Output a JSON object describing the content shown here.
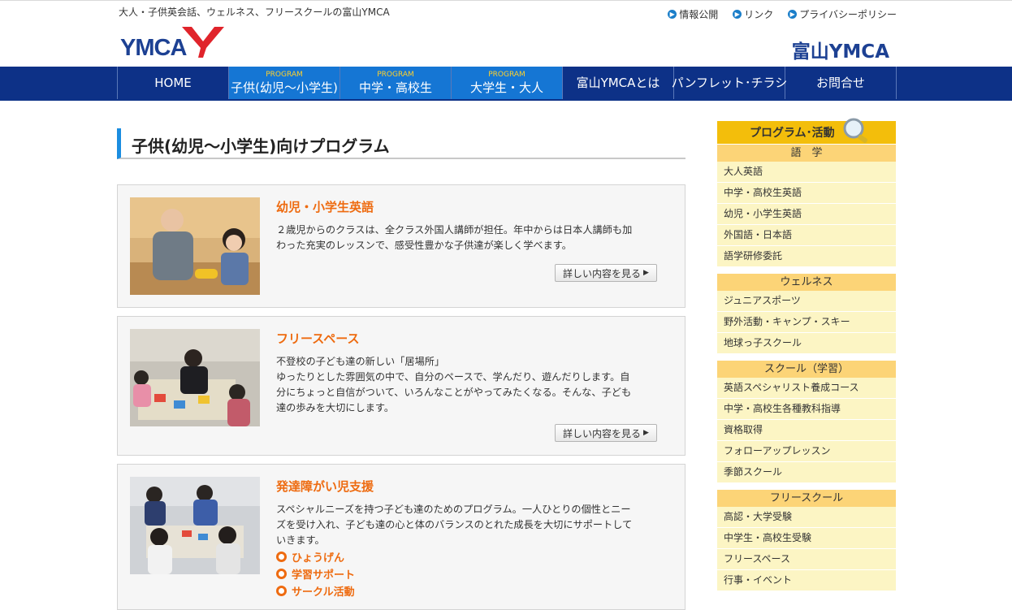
{
  "header": {
    "tagline": "大人・子供英会話、ウェルネス、フリースクールの富山YMCA",
    "utility_links": [
      "情報公開",
      "リンク",
      "プライバシーポリシー"
    ],
    "logo_text": "YMCA",
    "brand": "富山YMCA"
  },
  "nav": {
    "items": [
      {
        "sub": "",
        "label": "HOME"
      },
      {
        "sub": "PROGRAM",
        "label": "子供(幼児〜小学生)"
      },
      {
        "sub": "PROGRAM",
        "label": "中学・高校生"
      },
      {
        "sub": "PROGRAM",
        "label": "大学生・大人"
      },
      {
        "sub": "",
        "label": "富山YMCAとは"
      },
      {
        "sub": "",
        "label": "パンフレット･チラシ"
      },
      {
        "sub": "",
        "label": "お問合せ"
      }
    ]
  },
  "page": {
    "title": "子供(幼児〜小学生)向けプログラム"
  },
  "programs": [
    {
      "title": "幼児・小学生英語",
      "lines": [
        "２歳児からのクラスは、全クラス外国人講師が担任。年中からは日本人講師も加",
        "わった充実のレッスンで、感受性豊かな子供達が楽しく学べます。"
      ],
      "more": "詳しい内容を見る"
    },
    {
      "title": "フリースペース",
      "lines": [
        "不登校の子ども達の新しい「居場所」",
        "ゆったりとした雰囲気の中で、自分のペースで、学んだり、遊んだりします。自",
        "分にちょっと自信がついて、いろんなことがやってみたくなる。そんな、子ども",
        "達の歩みを大切にします。"
      ],
      "more": "詳しい内容を見る"
    },
    {
      "title": "発達障がい児支援",
      "lines": [
        "スペシャルニーズを持つ子ども達のためのプログラム。一人ひとりの個性とニー",
        "ズを受け入れ、子ども達の心と体のバランスのとれた成長を大切にサポートして",
        "いきます。"
      ],
      "links": [
        "ひょうげん",
        "学習サポート",
        "サークル活動"
      ]
    }
  ],
  "sidebar": {
    "header": "プログラム･活動",
    "categories": [
      {
        "name": "語　学",
        "items": [
          "大人英語",
          "中学・高校生英語",
          "幼児・小学生英語",
          "外国語・日本語",
          "語学研修委託"
        ]
      },
      {
        "name": "ウェルネス",
        "items": [
          "ジュニアスポーツ",
          "野外活動・キャンプ・スキー",
          "地球っ子スクール"
        ]
      },
      {
        "name": "スクール（学習）",
        "items": [
          "英語スペシャリスト養成コース",
          "中学・高校生各種教科指導",
          "資格取得",
          "フォローアップレッスン",
          "季節スクール"
        ]
      },
      {
        "name": "フリースクール",
        "items": [
          "高認・大学受験",
          "中学生・高校生受験",
          "フリースペース",
          "行事・イベント"
        ]
      }
    ]
  },
  "colors": {
    "nav_bg": "#0d3187",
    "nav_active": "#1576d4",
    "accent_orange": "#ee6b10",
    "sidebar_header": "#f3be0b",
    "sidebar_category": "#fcd477",
    "sidebar_row": "#fcf5c4",
    "brand_blue": "#1d4193"
  }
}
